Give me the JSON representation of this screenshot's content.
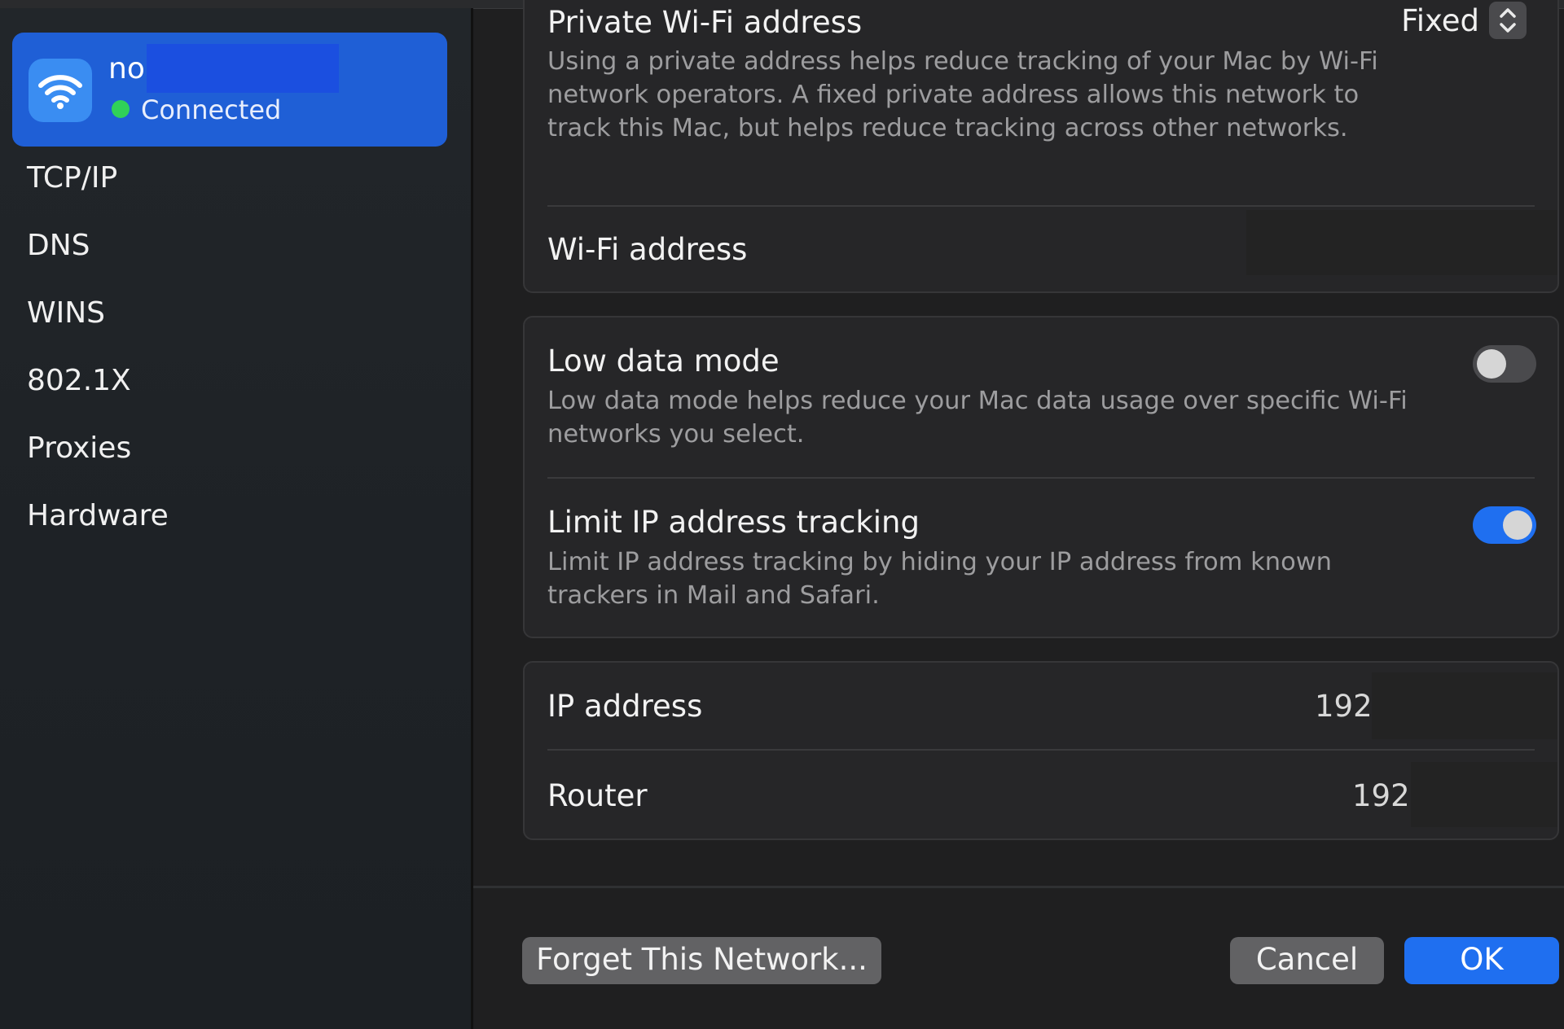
{
  "sidebar": {
    "network": {
      "name": "no",
      "status": "Connected"
    },
    "items": [
      {
        "label": "TCP/IP"
      },
      {
        "label": "DNS"
      },
      {
        "label": "WINS"
      },
      {
        "label": "802.1X"
      },
      {
        "label": "Proxies"
      },
      {
        "label": "Hardware"
      }
    ]
  },
  "private_address": {
    "title": "Private Wi-Fi address",
    "value": "Fixed",
    "description": "Using a private address helps reduce tracking of your Mac by Wi-Fi network operators. A fixed private address allows this network to track this Mac, but helps reduce tracking across other networks.",
    "wifi_address_label": "Wi-Fi address"
  },
  "low_data": {
    "title": "Low data mode",
    "description": "Low data mode helps reduce your Mac data usage over specific Wi-Fi networks you select.",
    "enabled": false
  },
  "limit_ip": {
    "title": "Limit IP address tracking",
    "description": "Limit IP address tracking by hiding your IP address from known trackers in Mail and Safari.",
    "enabled": true
  },
  "addresses": {
    "ip_label": "IP address",
    "ip_value": "192.",
    "router_label": "Router",
    "router_value": "192."
  },
  "buttons": {
    "forget": "Forget This Network...",
    "cancel": "Cancel",
    "ok": "OK"
  },
  "colors": {
    "accent": "#1f6ff0",
    "selection": "#1f5fd6",
    "connected": "#30d158"
  },
  "icons": [
    "wifi-icon",
    "status-dot-icon",
    "up-down-chevron-icon"
  ]
}
